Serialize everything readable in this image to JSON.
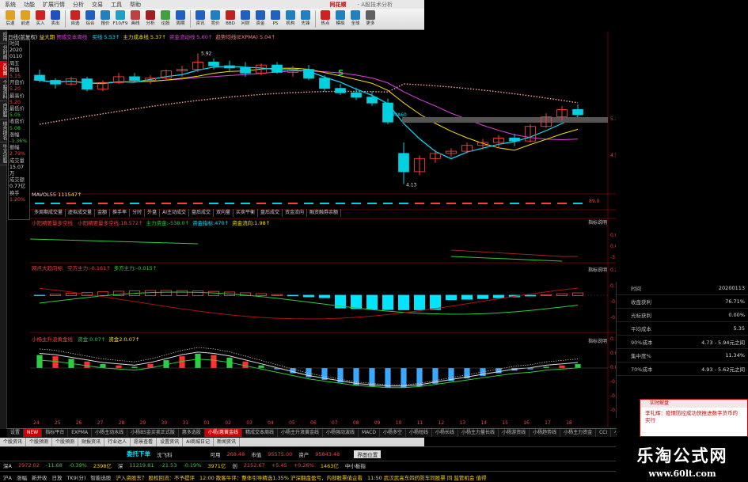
{
  "menubar": {
    "items": [
      "系统",
      "功能",
      "扩展行情",
      "分析",
      "交易",
      "工具",
      "帮助"
    ],
    "brand": "同花顺",
    "app_title": "- A股技术分析"
  },
  "toolbar": {
    "buttons": [
      {
        "label": "后退",
        "icon": "back-arrow-icon",
        "color": "#e0a020"
      },
      {
        "label": "前进",
        "icon": "forward-arrow-icon",
        "color": "#e0a020"
      },
      {
        "label": "买入",
        "icon": "buy-icon",
        "color": "#d02020"
      },
      {
        "label": "卖出",
        "icon": "sell-icon",
        "color": "#2050c0"
      },
      {
        "label": "自选",
        "icon": "star-icon",
        "color": "#d02020"
      },
      {
        "label": "综合",
        "icon": "grid-icon",
        "color": "#2060c0"
      },
      {
        "label": "报价",
        "icon": "list-icon",
        "color": "#2080c0"
      },
      {
        "label": "F10/F9",
        "icon": "f10-icon",
        "color": "#20a0c0"
      },
      {
        "label": "画线",
        "icon": "pencil-icon",
        "color": "#c04040"
      },
      {
        "label": "分析",
        "icon": "chart-icon",
        "color": "#a02020"
      },
      {
        "label": "论股",
        "icon": "chat-icon",
        "color": "#40a040"
      },
      {
        "label": "周期",
        "icon": "cycle-icon",
        "color": "#2060c0"
      },
      {
        "label": "资讯",
        "icon": "news-icon",
        "color": "#2060c0"
      },
      {
        "label": "竞价",
        "icon": "bid-icon",
        "color": "#2080c0"
      },
      {
        "label": "BBD",
        "icon": "bbd-icon",
        "color": "#c02020"
      },
      {
        "label": "问财",
        "icon": "search-icon",
        "color": "#2060c0"
      },
      {
        "label": "资金",
        "icon": "money-icon",
        "color": "#2060c0"
      },
      {
        "label": "PS",
        "icon": "ps-icon",
        "color": "#2060c0"
      },
      {
        "label": "机构",
        "icon": "org-icon",
        "color": "#2080c0"
      },
      {
        "label": "先锋",
        "icon": "pioneer-icon",
        "color": "#2080c0"
      },
      {
        "label": "热点",
        "icon": "hot-icon",
        "color": "#d02020"
      },
      {
        "label": "模拟",
        "icon": "sim-icon",
        "color": "#2080c0"
      },
      {
        "label": "全球",
        "icon": "globe-icon",
        "color": "#2080c0"
      },
      {
        "label": "更多",
        "icon": "more-icon",
        "color": "#606060"
      }
    ]
  },
  "left_tabs": [
    "应用",
    "分时图",
    "K线图",
    "个股资料",
    "自选股",
    "综合排名",
    "牛叉诊股"
  ],
  "data_window": [
    {
      "k": "时间",
      "v": "2020",
      "c": "vc"
    },
    {
      "k": "",
      "v": "0110",
      "c": "vc"
    },
    {
      "k": "周五",
      "v": "",
      "c": "vc"
    },
    {
      "k": "数值",
      "v": "",
      "c": "vc"
    },
    {
      "k": "",
      "v": "5.15",
      "c": "v"
    },
    {
      "k": "开盘价",
      "v": "",
      "c": "vc"
    },
    {
      "k": "",
      "v": "5.20",
      "c": "v"
    },
    {
      "k": "最高价",
      "v": "",
      "c": "vc"
    },
    {
      "k": "",
      "v": "5.20",
      "c": "v"
    },
    {
      "k": "最低价",
      "v": "",
      "c": "vc"
    },
    {
      "k": "",
      "v": "5.05",
      "c": "vg"
    },
    {
      "k": "收盘价",
      "v": "",
      "c": "vc"
    },
    {
      "k": "",
      "v": "5.08",
      "c": "vg"
    },
    {
      "k": "涨幅",
      "v": "",
      "c": "vc"
    },
    {
      "k": "",
      "v": "-1.36%",
      "c": "vg"
    },
    {
      "k": "振幅",
      "v": "",
      "c": "vc"
    },
    {
      "k": "",
      "v": "2.79%",
      "c": "v"
    },
    {
      "k": "成交量",
      "v": "",
      "c": "vc"
    },
    {
      "k": "",
      "v": "15.07万",
      "c": "vc"
    },
    {
      "k": "成交额",
      "v": "",
      "c": "vc"
    },
    {
      "k": "",
      "v": "0.77亿",
      "c": "vc"
    },
    {
      "k": "换手",
      "v": "",
      "c": "vc"
    },
    {
      "k": "",
      "v": "1.20%",
      "c": "v"
    }
  ],
  "main_header": {
    "period": "日线(前复权)",
    "name": "益大期",
    "indicator": "预成交本周线",
    "mas": [
      {
        "label": "买线 5.53↑",
        "color": "#00e5ff"
      },
      {
        "label": "主力成本线 5.37↑",
        "color": "#f5e000"
      },
      {
        "label": "资金流动线 5.60↑",
        "color": "#e040e0"
      },
      {
        "label": "趋势均线(EXPMA) 5.04↑",
        "color": "#ff8080"
      }
    ]
  },
  "price_labels": {
    "high": "5.92",
    "low": "4.13",
    "s_mark": "S",
    "ema_text": "EMA60"
  },
  "axis_labels": [
    "5.33",
    "4.53"
  ],
  "volume_header": {
    "label": "MAVOL55",
    "value": "111547↑",
    "axis_right": "89.0"
  },
  "indicator_tabs": [
    "多周期成交量",
    "虚拟成交量",
    "金额",
    "换手率",
    "分时",
    "外盘",
    "AI主动成交",
    "盘后成交",
    "双向量",
    "买卖平衡",
    "盘后成交",
    "资金流向",
    "融资融券余额"
  ],
  "panel1": {
    "title": "小阳精要量多空线",
    "values": [
      {
        "label": "小阳精要量多空线:18.572↑",
        "color": "#ff3c3c"
      },
      {
        "label": "主力资金:-538.0↑",
        "color": "#2ecc40"
      },
      {
        "label": "资金指标:470↑",
        "color": "#00e5ff"
      },
      {
        "label": "资金流向:1.98↑",
        "color": "#f5e000"
      }
    ],
    "axis": [
      "0.07",
      "0.00",
      "-3.10"
    ],
    "right_label": "指标说明"
  },
  "panel2": {
    "title": "网点大趋向标",
    "values": [
      {
        "label": "空方主力:-0.161↑",
        "color": "#ff3c3c"
      },
      {
        "label": "多方主力:-0.015↑",
        "color": "#2ecc40"
      }
    ],
    "axis": [
      "0.274",
      "0.149",
      "-0.031",
      "-0.461"
    ],
    "right_label": "指标说明"
  },
  "panel3": {
    "title": "小杨主升浪黄金线",
    "values": [
      {
        "label": "资金:0.07↑",
        "color": "#2ecc40"
      },
      {
        "label": "资金2:0.07↑",
        "color": "#f5e000"
      }
    ],
    "axis": [
      "0.125",
      "0.038",
      "0.030",
      "-0.037",
      "-0.105",
      "-0.157"
    ],
    "right_label": "指标说明"
  },
  "x_axis": [
    "24",
    "25",
    "26",
    "27",
    "28",
    "29",
    "30",
    "31",
    "01",
    "02",
    "03",
    "04",
    "05",
    "06",
    "07",
    "08",
    "09",
    "10",
    "11",
    "12",
    "13",
    "14",
    "15",
    "16",
    "17",
    "18"
  ],
  "bottom_tabs": [
    "设置",
    "NEW",
    "指标平台",
    "EXPMA",
    "小杨主动水线",
    "小杨BS金买卖正式版",
    "惠多选股",
    "小杨/惠黄金线",
    "精成交本周线",
    "小杨主升浪黄金线",
    "小杨强动波线",
    "MACD",
    "小杨多空",
    "小杨短线",
    "小杨长线",
    "小杨主力量长线",
    "小杨游资线",
    "小杨趋势线",
    "小杨主力资金",
    "CCI",
    "小杨超短线",
    "小杨宝箱"
  ],
  "active_bottom_tab": "小杨/惠黄金线",
  "func_bar": [
    "个股资讯",
    "个股预测",
    "个股预测",
    "财报资讯",
    "行业达人",
    "愿景查看",
    "设置资讯",
    "AI商城日记",
    "新闻资讯"
  ],
  "order_bar": {
    "title": "委托下单",
    "code_label": "沈飞科",
    "available_label": "可用",
    "available": "268.48",
    "market_label": "市值",
    "market": "95575.00",
    "assets_label": "资产",
    "assets": "95843.48",
    "btn": "界面位置"
  },
  "quote_bar": [
    {
      "label": "深A",
      "value": "2972.02",
      "color": "#ff3c3c"
    },
    {
      "label": "",
      "value": "-11.68",
      "color": "#2ecc40"
    },
    {
      "label": "",
      "value": "-0.39%",
      "color": "#2ecc40"
    },
    {
      "label": "",
      "value": "2398亿",
      "color": "#ffd000"
    },
    {
      "label": "深",
      "value": "11219.81",
      "color": "#2ecc40"
    },
    {
      "label": "",
      "value": "-21.53",
      "color": "#2ecc40"
    },
    {
      "label": "",
      "value": "-0.19%",
      "color": "#2ecc40"
    },
    {
      "label": "",
      "value": "3971亿",
      "color": "#ffd000"
    },
    {
      "label": "创",
      "value": "2152.67",
      "color": "#ff3c3c"
    },
    {
      "label": "",
      "value": "+5.45",
      "color": "#ff3c3c"
    },
    {
      "label": "",
      "value": "+0.26%",
      "color": "#ff3c3c"
    },
    {
      "label": "",
      "value": "1463亿",
      "color": "#ffd000"
    },
    {
      "label": "",
      "value": "中小板指",
      "color": "#ddd"
    }
  ],
  "ticker": [
    "沪A",
    "涨幅",
    "新开收",
    "日放",
    "TK9(分)",
    "智能选股",
    "沪入资股东？ 股权回流：不予提评",
    "12:00 散客牛评：整体引导精选1.35% 沪深翻盘盈亏，内部股票值企看",
    "11:50 武汉武高东四药防车同股票 同 监管机会 值得"
  ],
  "right_panel": [
    {
      "k": "时间",
      "v": "20200113",
      "c": ""
    },
    {
      "k": "收盘获利",
      "v": "76.71%",
      "c": ""
    },
    {
      "k": "光标获利",
      "v": "0.00%",
      "c": ""
    },
    {
      "k": "平均成本",
      "v": "5.35",
      "c": ""
    },
    {
      "k": "90%成本",
      "v": "4.73 -     5.94元之间",
      "c": ""
    },
    {
      "k": "集中度%",
      "v": "11.34%",
      "c": ""
    },
    {
      "k": "70%成本",
      "v": "4.93 -     5.62元之间",
      "c": ""
    }
  ],
  "popup": {
    "header": "实时解盘",
    "body": "李礼辉：疫情防控成功快推进数字货币的实行"
  },
  "watermark": {
    "line1": "乐淘公式网",
    "line2": "www.60lt.com"
  },
  "colors": {
    "up": "#ff3c3c",
    "down": "#00d0e0",
    "ma_cyan": "#00e5ff",
    "ma_yellow": "#f5e000",
    "ma_magenta": "#e040e0",
    "ema_dots": "#ffa0a0"
  },
  "candles": [
    [
      5.62,
      5.7,
      5.52,
      5.55
    ],
    [
      5.55,
      5.58,
      5.44,
      5.5
    ],
    [
      5.5,
      5.6,
      5.48,
      5.57
    ],
    [
      5.57,
      5.6,
      5.4,
      5.43
    ],
    [
      5.43,
      5.55,
      5.4,
      5.52
    ],
    [
      5.52,
      5.65,
      5.5,
      5.6
    ],
    [
      5.6,
      5.65,
      5.52,
      5.55
    ],
    [
      5.55,
      5.62,
      5.5,
      5.58
    ],
    [
      5.58,
      5.7,
      5.55,
      5.68
    ],
    [
      5.68,
      5.75,
      5.6,
      5.7
    ],
    [
      5.7,
      5.92,
      5.66,
      5.8
    ],
    [
      5.8,
      5.85,
      5.7,
      5.75
    ],
    [
      5.75,
      5.82,
      5.68,
      5.72
    ],
    [
      5.72,
      5.8,
      5.6,
      5.65
    ],
    [
      5.65,
      5.78,
      5.62,
      5.76
    ],
    [
      5.76,
      5.8,
      5.64,
      5.66
    ],
    [
      5.66,
      5.75,
      5.6,
      5.7
    ],
    [
      5.7,
      5.76,
      5.55,
      5.58
    ],
    [
      5.58,
      5.62,
      5.4,
      5.44
    ],
    [
      5.44,
      5.5,
      5.35,
      5.38
    ],
    [
      5.38,
      5.45,
      5.28,
      5.32
    ],
    [
      5.32,
      5.4,
      5.2,
      5.24
    ],
    [
      5.24,
      5.3,
      4.95,
      4.98
    ],
    [
      4.55,
      4.7,
      4.13,
      4.3
    ],
    [
      4.3,
      4.52,
      4.25,
      4.48
    ],
    [
      4.48,
      4.6,
      4.42,
      4.55
    ],
    [
      4.55,
      4.62,
      4.5,
      4.58
    ],
    [
      4.58,
      4.7,
      4.55,
      4.66
    ],
    [
      4.66,
      4.75,
      4.6,
      4.7
    ],
    [
      4.7,
      4.8,
      4.62,
      4.76
    ],
    [
      4.76,
      4.82,
      4.65,
      4.72
    ],
    [
      4.72,
      4.95,
      4.7,
      4.92
    ],
    [
      4.92,
      5.1,
      4.9,
      5.05
    ],
    [
      5.05,
      5.2,
      5.0,
      5.15
    ],
    [
      5.15,
      5.22,
      5.05,
      5.08
    ]
  ],
  "panel3_bars": [
    0.1,
    0.09,
    0.07,
    0.05,
    0.03,
    0.02,
    0.01,
    0.03,
    0.06,
    0.09,
    0.11,
    0.1,
    0.08,
    0.05,
    0.02,
    -0.01,
    -0.04,
    -0.07,
    -0.09,
    -0.11,
    -0.13,
    -0.14,
    -0.15,
    -0.15,
    -0.14,
    -0.12,
    -0.1,
    -0.08,
    -0.06,
    -0.04,
    -0.02,
    -0.01,
    0.01,
    0.02,
    0.03
  ]
}
